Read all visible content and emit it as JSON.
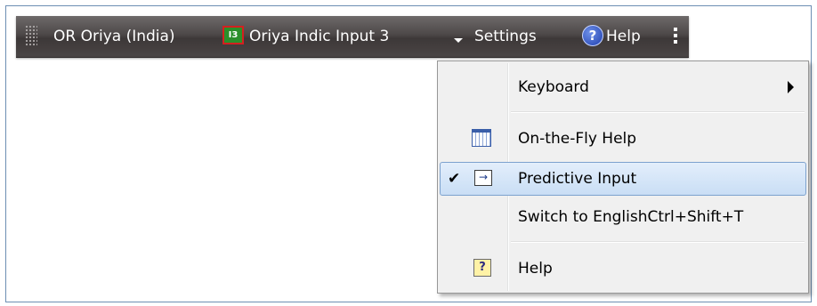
{
  "langbar": {
    "language": "OR Oriya (India)",
    "ime_icon_text": "I3",
    "ime_name": "Oriya Indic Input 3",
    "settings_label": "Settings",
    "help_label": "Help",
    "help_glyph": "?"
  },
  "menu": {
    "items": [
      {
        "label": "Keyboard",
        "has_submenu": true
      },
      {
        "label": "On-the-Fly Help",
        "icon": "table-grid-icon"
      },
      {
        "label": "Predictive Input",
        "icon": "predictive-input-icon",
        "checked": true,
        "check_glyph": "✔",
        "icon_glyph": "→"
      },
      {
        "label": "Switch to EnglishCtrl+Shift+T"
      },
      {
        "label": "Help",
        "icon": "help-book-icon",
        "icon_glyph": "?"
      }
    ]
  },
  "colors": {
    "langbar_bg": "#4d4848",
    "menu_bg": "#f0f0f0",
    "highlight": "#c9def5"
  }
}
